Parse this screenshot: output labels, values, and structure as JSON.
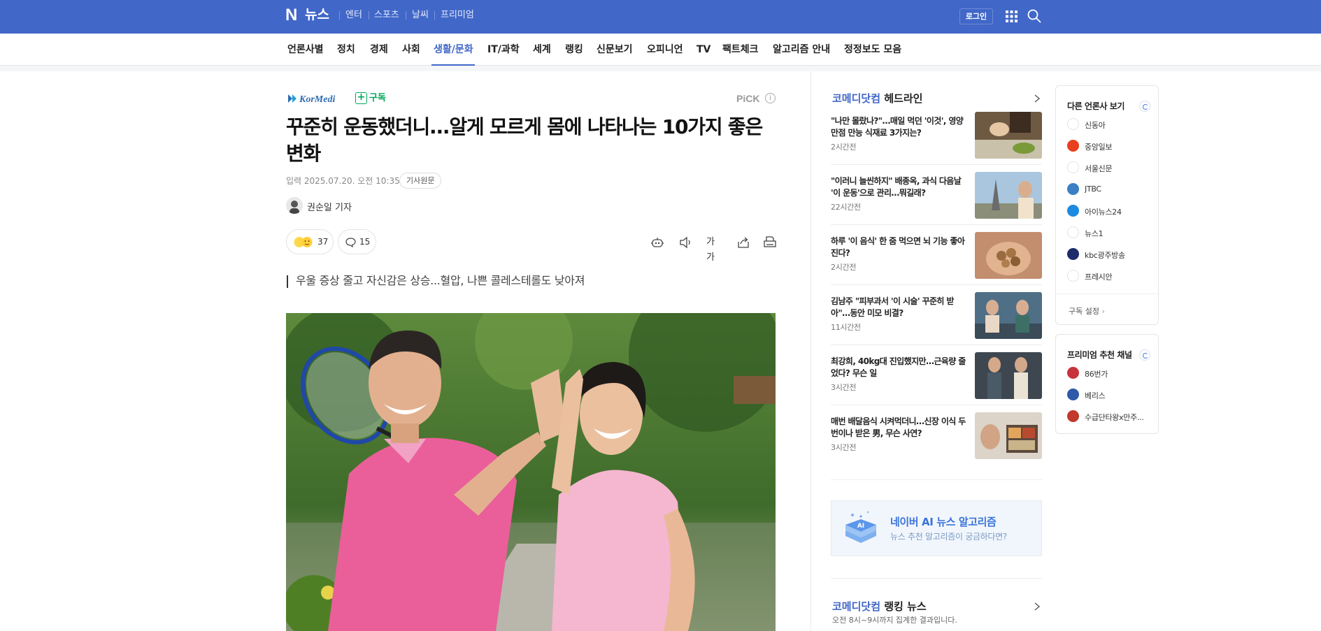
{
  "topbar": {
    "logo_n": "N",
    "logo_text": "뉴스",
    "services": [
      "엔터",
      "스포츠",
      "날씨",
      "프리미엄"
    ],
    "login": "로그인"
  },
  "categories": [
    "언론사별",
    "정치",
    "경제",
    "사회",
    "생활/문화",
    "IT/과학",
    "세계",
    "랭킹",
    "신문보기",
    "오피니언",
    "TV",
    "팩트체크",
    "알고리즘 안내",
    "정정보도 모음"
  ],
  "active_category": "생활/문화",
  "article": {
    "press": "KorMedi",
    "subscribe": "구독",
    "pick": "PiCK",
    "pick_info": "i",
    "headline": "꾸준히 운동했더니...알게 모르게 몸에 나타나는 10가지 좋은 변화",
    "date": "입력 2025.07.20. 오전 10:35",
    "original_link": "기사원문",
    "reporter": "권순일 기자",
    "reaction_count": "37",
    "comment_count": "15",
    "font_size_label": "가가",
    "subtitle": "우울 증상 줄고 자신감은 상승...혈압, 나쁜 콜레스테롤도 낮아져"
  },
  "headlines": {
    "press": "코메디닷컴",
    "title": "헤드라인",
    "items": [
      {
        "title": "\"나만 몰랐나?\"…매일 먹던 '이것', 영양 만점 만능 식재료 3가지는?",
        "time": "2시간전"
      },
      {
        "title": "\"이러니 늘씬하지\" 배종옥, 과식 다음날 '이 운동'으로 관리…뭐길래?",
        "time": "22시간전"
      },
      {
        "title": "하루 '이 음식' 한 줌 먹으면 뇌 기능 좋아진다?",
        "time": "2시간전"
      },
      {
        "title": "김남주 \"피부과서 '이 시술' 꾸준히 받아\"…동안 미모 비결?",
        "time": "11시간전"
      },
      {
        "title": "최강희, 40kg대 진입했지만…근육량 줄었다? 무슨 일",
        "time": "3시간전"
      },
      {
        "title": "매번 배달음식 시켜먹더니…신장 이식 두 번이나 받은 男, 무슨 사연?",
        "time": "3시간전"
      }
    ]
  },
  "ai_banner": {
    "title": "네이버 AI 뉴스 알고리즘",
    "subtitle": "뉴스 추천 알고리즘이 궁금하다면?",
    "badge": "AI"
  },
  "ranking": {
    "press": "코메디닷컴",
    "title": "랭킹 뉴스",
    "subtitle": "오전 8시~9시까지 집계한 결과입니다."
  },
  "other_press": {
    "title": "다른 언론사 보기",
    "items": [
      "신동아",
      "중앙일보",
      "서울신문",
      "JTBC",
      "아이뉴스24",
      "뉴스1",
      "kbc광주방송",
      "프레시안"
    ],
    "setting": "구독 설정"
  },
  "premium": {
    "title": "프리미엄 추천 채널",
    "items": [
      "86번가",
      "베리스",
      "수급단타왕x만주..."
    ]
  },
  "colors": {
    "brand": "#4167c8",
    "subscribe_green": "#00a85a"
  }
}
